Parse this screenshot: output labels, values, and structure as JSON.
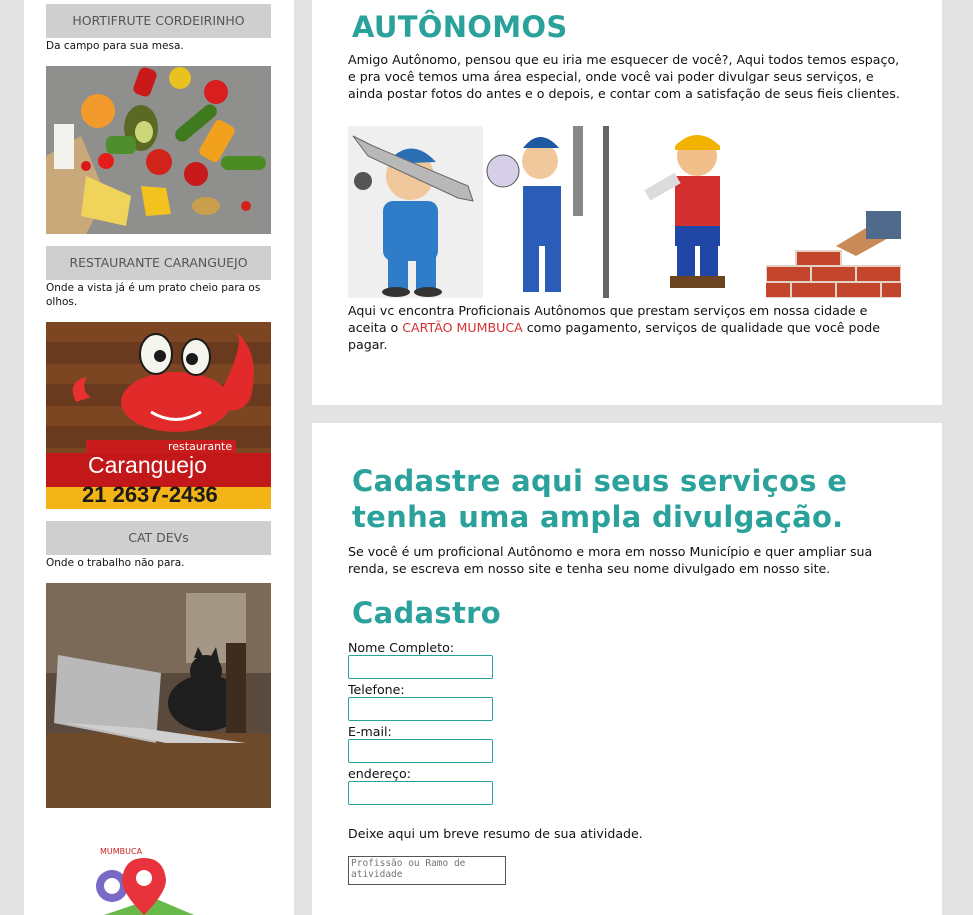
{
  "sidebar": {
    "ads": [
      {
        "title": "HORTIFRUTE CORDEIRINHO",
        "description": "Da campo para sua mesa."
      },
      {
        "title": "RESTAURANTE CARANGUEJO",
        "description": "Onde a vista já é um prato cheio para os olhos."
      },
      {
        "title": "CAT DEVs",
        "description": "Onde o trabalho não para."
      }
    ],
    "caranguejo_sign": {
      "small": "restaurante",
      "name": "Caranguejo",
      "phone": "21 2637-2436"
    },
    "logo_text": "MUMBUCA GO"
  },
  "autonomos": {
    "heading": "AUTÔNOMOS",
    "intro": "Amigo Autônomo, pensou que eu iria me esquecer de você?, Aqui todos temos espaço, e pra você temos uma área especial, onde você vai poder divulgar seus serviços, e ainda postar fotos do antes e o depois, e contar com a satisfação de seus fieis clientes.",
    "outro_before": "Aqui vc encontra Proficionais Autônomos que prestam serviços em nossa cidade e aceita o ",
    "outro_highlight": "CARTÃO MUMBUCA",
    "outro_after": " como pagamento, serviços de qualidade que você pode pagar.",
    "highlight_color": "#d43030"
  },
  "cadastre": {
    "heading": "Cadastre aqui seus serviços e tenha uma ampla divulgação.",
    "text": "Se você é um proficional Autônomo e mora em nosso Município e quer ampliar sua renda, se escreva em nosso site e tenha seu nome divulgado em nosso site.",
    "form_heading": "Cadastro",
    "fields": [
      {
        "label": "Nome Completo:",
        "value": ""
      },
      {
        "label": "Telefone:",
        "value": ""
      },
      {
        "label": "E-mail:",
        "value": ""
      },
      {
        "label": "endereço:",
        "value": ""
      }
    ],
    "resumo_label": "Deixe aqui um breve resumo de sua atividade.",
    "resumo_placeholder": "Profissão ou Ramo de atividade"
  },
  "colors": {
    "accent": "#2aa29b",
    "ad_header": "#cfcfcf",
    "background": "#e3e3e3"
  }
}
